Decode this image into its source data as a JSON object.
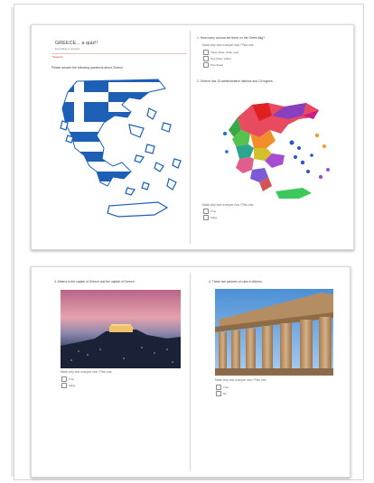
{
  "page1": {
    "left": {
      "title": "GREECE... a quiz!!",
      "subtitle": "Everything is required.",
      "required_note": "* Required",
      "intro": "Please answer the following questions about Greece"
    },
    "right": {
      "q1": {
        "text": "1.    How many colours are there on the Greek flag?",
        "hint": "Mark only one oval per row / Pick one",
        "options": [
          "Three (blue, white, red)",
          "Two (blue, white)",
          "One (blue)"
        ]
      },
      "q2": {
        "text": "2.    Greece has 13 administrative districts and 13 regions.",
        "hint": "Mark only one oval per row / Pick one",
        "options": [
          "True",
          "False"
        ]
      }
    }
  },
  "page2": {
    "left": {
      "q3": {
        "text": "3.    Athens is the capital of Greece and the capital of Greece.",
        "hint": "Mark only one oval per row / Pick one",
        "options": [
          "True",
          "False"
        ]
      }
    },
    "right": {
      "q4": {
        "text": "4.    These are pictures of ruins in Athens.",
        "hint": "Mark only one oval per row / Pick one",
        "options": [
          "True",
          "No"
        ]
      }
    }
  },
  "colors": {
    "flag_blue": "#1d5fb5",
    "flag_white": "#ffffff",
    "required_red": "#d93025",
    "sky_top": "#c86a86",
    "sky_mid": "#e9a9b0",
    "night": "#1b2840",
    "column_stone": "#b99066",
    "blue_sky": "#5a9fdc"
  }
}
